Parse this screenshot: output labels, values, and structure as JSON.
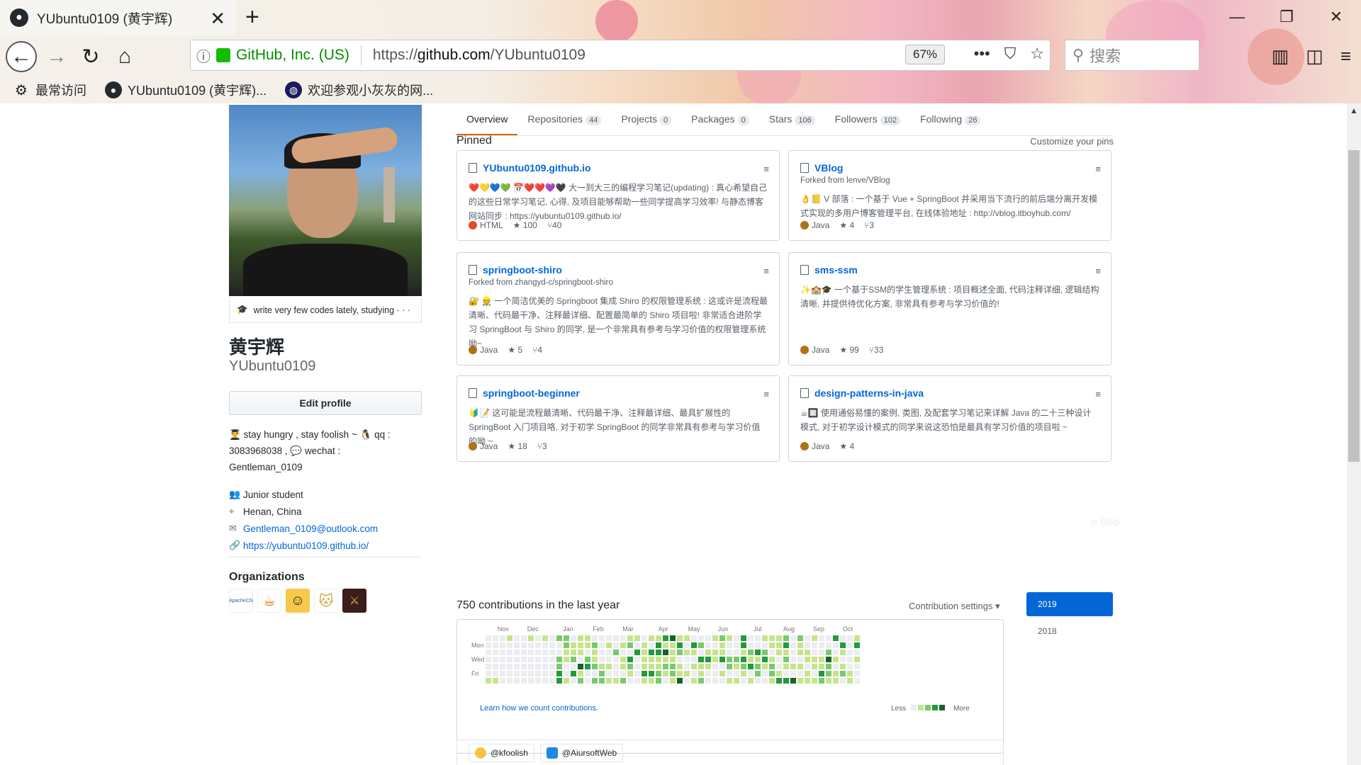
{
  "browser": {
    "tab_title": "YUbuntu0109 (黄宇辉)",
    "new_tab": "+",
    "url_info_icon": "info-icon",
    "org_name": "GitHub, Inc. (US)",
    "url_prefix": "https://",
    "url_domain": "github.com",
    "url_path": "/YUbuntu0109",
    "zoom": "67%",
    "search_placeholder": "搜索",
    "bookmarks": [
      {
        "label": "最常访问",
        "icon": "gear-icon"
      },
      {
        "label": "YUbuntu0109 (黄宇辉)...",
        "icon": "github-icon"
      },
      {
        "label": "欢迎参观小灰灰的网...",
        "icon": "globe-icon"
      }
    ]
  },
  "profile": {
    "status": "write very few codes lately, studying · · ·",
    "full_name": "黄宇辉",
    "username": "YUbuntu0109",
    "edit_button": "Edit profile",
    "bio_1": "stay hungry , stay foolish ~",
    "bio_2": "qq :",
    "bio_3": "3083968038 ,",
    "bio_4": "wechat :",
    "bio_5": "Gentleman_0109",
    "company": "Junior student",
    "location": "Henan, China",
    "email": "Gentleman_0109@outlook.com",
    "website": "https://yubuntu0109.github.io/",
    "organizations_title": "Organizations",
    "org_labels": [
      "ApacheCN",
      "",
      "",
      "",
      ""
    ]
  },
  "tabs": [
    {
      "label": "Overview",
      "count": ""
    },
    {
      "label": "Repositories",
      "count": "44"
    },
    {
      "label": "Projects",
      "count": "0"
    },
    {
      "label": "Packages",
      "count": "0"
    },
    {
      "label": "Stars",
      "count": "106"
    },
    {
      "label": "Followers",
      "count": "102"
    },
    {
      "label": "Following",
      "count": "26"
    }
  ],
  "pinned": {
    "title": "Pinned",
    "customize": "Customize your pins",
    "repos": [
      {
        "name": "YUbuntu0109.github.io",
        "forked": "",
        "desc": "❤️💛💙💚 📅❤️❤️💜🖤 大一到大三的编程学习笔记(updating) : 真心希望自己的这些日常学习笔记, 心得, 及项目能够帮助一些同学提高学习效率! 与静态博客网站同步 : https://yubuntu0109.github.io/",
        "lang": "HTML",
        "lang_color": "#e34c26",
        "stars": "100",
        "forks": "40"
      },
      {
        "name": "VBlog",
        "forked": "Forked from lenve/VBlog",
        "desc": "👌📒 V 部落 : 一个基于 Vue + SpringBoot 并采用当下流行的前后端分离开发模式实现的多用户博客管理平台, 在线体验地址 : http://vblog.itboyhub.com/",
        "lang": "Java",
        "lang_color": "#b07219",
        "stars": "4",
        "forks": "3"
      },
      {
        "name": "springboot-shiro",
        "forked": "Forked from zhangyd-c/springboot-shiro",
        "desc": "🔐 👷 一个简洁优美的 Springboot 集成 Shiro 的权限管理系统 : 这或许是流程最清晰、代码最干净、注释最详细、配置最简单的 Shiro 项目啦! 非常适合进阶学习 SpringBoot 与 Shiro 的同学, 是一个非常具有参考与学习价值的权限管理系统呦~",
        "lang": "Java",
        "lang_color": "#b07219",
        "stars": "5",
        "forks": "4"
      },
      {
        "name": "sms-ssm",
        "forked": "",
        "desc": "✨🏫🎓 一个基于SSM的学生管理系统 : 项目概述全面, 代码注释详细, 逻辑结构清晰, 并提供待优化方案, 非常具有参考与学习价值的!",
        "lang": "Java",
        "lang_color": "#b07219",
        "stars": "99",
        "forks": "33"
      },
      {
        "name": "springboot-beginner",
        "forked": "",
        "desc": "🔰📝 这可能是流程最清晰、代码最干净、注释最详细、最具扩展性的 SpringBoot 入门项目咯, 对于初学 SpringBoot 的同学非常具有参考与学习价值的呦 ~",
        "lang": "Java",
        "lang_color": "#b07219",
        "stars": "18",
        "forks": "3"
      },
      {
        "name": "design-patterns-in-java",
        "forked": "",
        "desc": "☕🔲 使用通俗易懂的案例, 类图, 及配套学习笔记来详解 Java 的二十三种设计模式, 对于初学设计模式的同学来说这恐怕是最具有学习价值的项目啦 ~",
        "lang": "Java",
        "lang_color": "#b07219",
        "stars": "4",
        "forks": ""
      }
    ]
  },
  "contributions": {
    "title": "750 contributions in the last year",
    "settings": "Contribution settings ▾",
    "months": [
      "Nov",
      "Dec",
      "Jan",
      "Feb",
      "Mar",
      "Apr",
      "May",
      "Jun",
      "Jul",
      "Aug",
      "Sep",
      "Oct"
    ],
    "days": [
      "Mon",
      "Wed",
      "Fri"
    ],
    "learn": "Learn how we count contributions.",
    "less": "Less",
    "more": "More",
    "years": [
      "2019",
      "2018"
    ]
  },
  "activity": {
    "chips": [
      "@kfoolish",
      "@AiursoftWeb"
    ]
  },
  "ghost_text": "n Snip",
  "colors": {
    "link": "#0366d6",
    "active_tab_border": "#e36209",
    "contrib_levels": [
      "#ebedf0",
      "#c6e48b",
      "#7bc96f",
      "#239a3b",
      "#196127"
    ]
  }
}
